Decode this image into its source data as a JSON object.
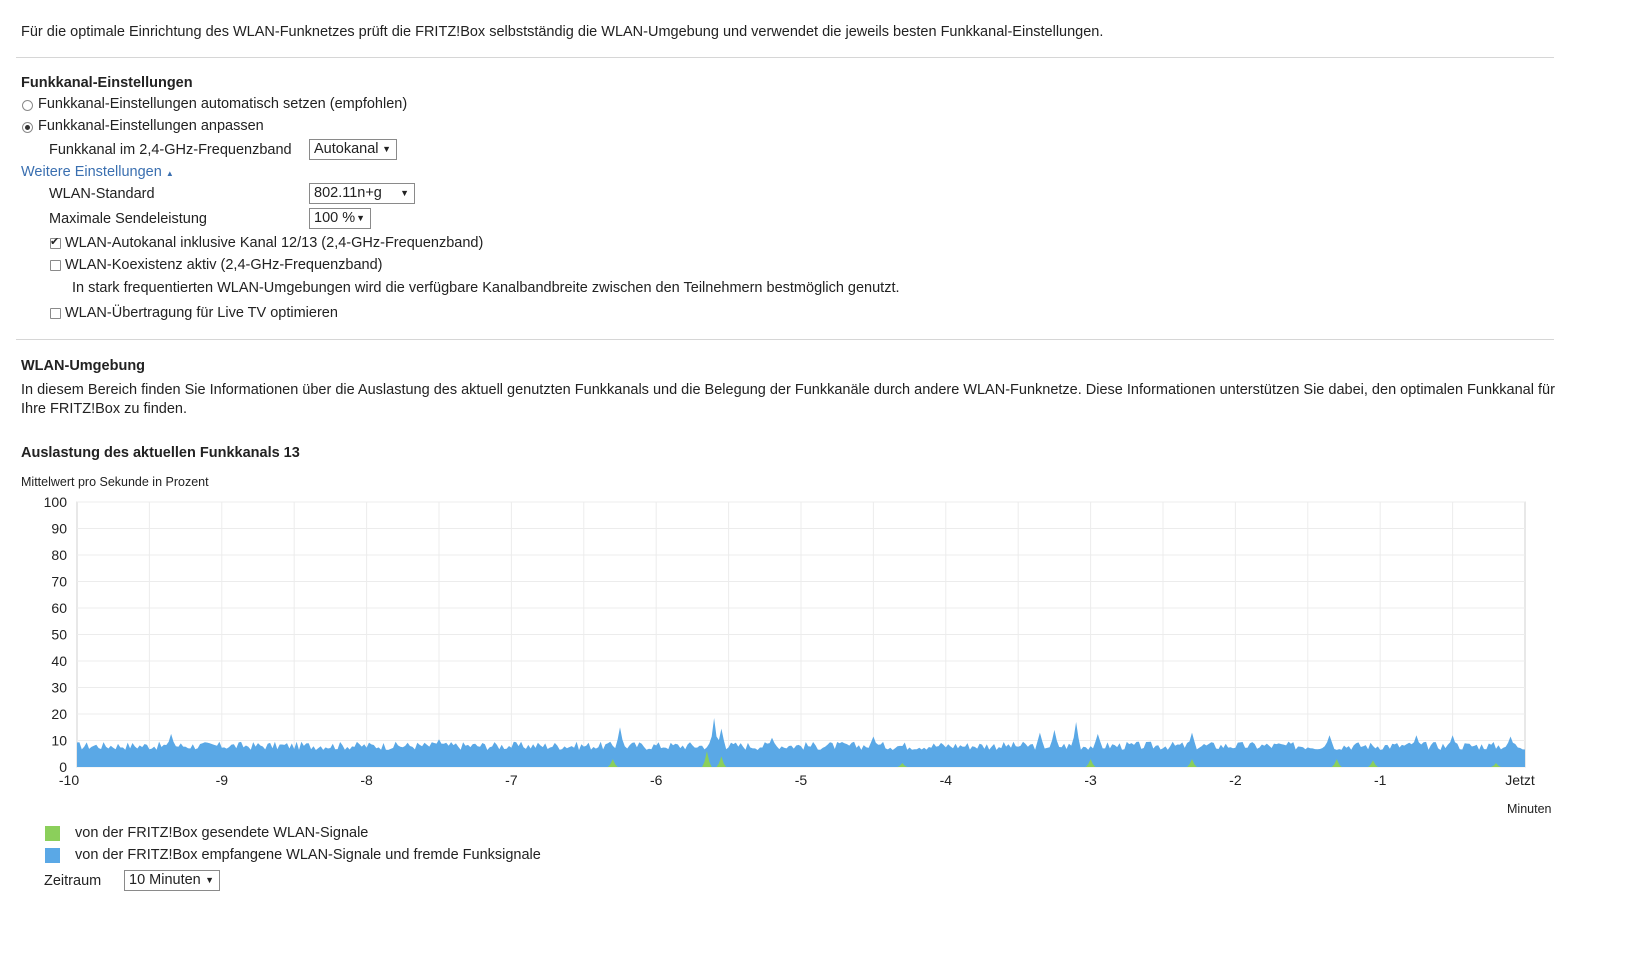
{
  "intro": "Für die optimale Einrichtung des WLAN-Funknetzes prüft die FRITZ!Box selbstständig die WLAN-Umgebung und verwendet die jeweils besten Funkkanal-Einstellungen.",
  "channel_settings": {
    "heading": "Funkkanal-Einstellungen",
    "radio_auto": "Funkkanal-Einstellungen automatisch setzen (empfohlen)",
    "radio_manual": "Funkkanal-Einstellungen anpassen",
    "selected_mode": "manual",
    "band_label": "Funkkanal im 2,4-GHz-Frequenzband",
    "band_value": "Autokanal"
  },
  "more_settings": {
    "link": "Weitere Einstellungen",
    "standard_label": "WLAN-Standard",
    "standard_value": "802.11n+g",
    "power_label": "Maximale Sendeleistung",
    "power_value": "100 %",
    "autochannel_label": "WLAN-Autokanal inklusive Kanal 12/13 (2,4-GHz-Frequenzband)",
    "autochannel_checked": true,
    "coexistence_label": "WLAN-Koexistenz aktiv (2,4-GHz-Frequenzband)",
    "coexistence_checked": false,
    "coexistence_hint": "In stark frequentierten WLAN-Umgebungen wird die verfügbare Kanalbandbreite zwischen den Teilnehmern bestmöglich genutzt.",
    "livetv_label": "WLAN-Übertragung für Live TV optimieren",
    "livetv_checked": false
  },
  "environment": {
    "heading": "WLAN-Umgebung",
    "description_line1": "In diesem Bereich finden Sie Informationen über die Auslastung des aktuell genutzten Funkkanals und die Belegung der Funkkanäle durch andere WLAN-Funknetze. Diese Informationen unterstützen Sie dabei, den optimalen Funkkanal für",
    "description_line2": "Ihre FRITZ!Box zu finden."
  },
  "chart_data": {
    "type": "area",
    "title": "Auslastung des aktuellen Funkkanals 13",
    "ylabel": "Mittelwert pro Sekunde in Prozent",
    "xlabel": "Minuten",
    "xlim": [
      -10,
      0
    ],
    "ylim": [
      0,
      100
    ],
    "x_ticks": [
      "-10",
      "-9",
      "-8",
      "-7",
      "-6",
      "-5",
      "-4",
      "-3",
      "-2",
      "-1",
      "Jetzt"
    ],
    "y_ticks": [
      0,
      10,
      20,
      30,
      40,
      50,
      60,
      70,
      80,
      90,
      100
    ],
    "grid": true,
    "series": [
      {
        "name": "von der FRITZ!Box empfangene WLAN-Signale und fremde Funksignale",
        "color": "#5aa8e6",
        "baseline": 8,
        "peaks": [
          [
            -9.35,
            12.5
          ],
          [
            -7.5,
            10.5
          ],
          [
            -6.25,
            15
          ],
          [
            -5.6,
            18.5
          ],
          [
            -5.55,
            14.5
          ],
          [
            -5.2,
            11
          ],
          [
            -4.5,
            11.5
          ],
          [
            -3.35,
            13
          ],
          [
            -3.25,
            14
          ],
          [
            -3.1,
            17
          ],
          [
            -2.95,
            12.5
          ],
          [
            -2.3,
            13
          ],
          [
            -1.35,
            12
          ],
          [
            -0.75,
            12
          ],
          [
            -0.5,
            12
          ],
          [
            -0.1,
            11.5
          ]
        ]
      },
      {
        "name": "von der FRITZ!Box gesendete WLAN-Signale",
        "color": "#8bcf5b",
        "baseline": 0,
        "peaks": [
          [
            -6.3,
            3
          ],
          [
            -5.65,
            6
          ],
          [
            -5.55,
            4
          ],
          [
            -4.3,
            1.5
          ],
          [
            -3.0,
            3
          ],
          [
            -2.3,
            3
          ],
          [
            -1.3,
            3
          ],
          [
            -1.05,
            2.5
          ],
          [
            -0.2,
            1.5
          ]
        ]
      }
    ],
    "legend_position": "bottom-left"
  },
  "legend": {
    "sent_label": "von der FRITZ!Box gesendete WLAN-Signale",
    "received_label": "von der FRITZ!Box empfangene WLAN-Signale und fremde Funksignale"
  },
  "period": {
    "label": "Zeitraum",
    "value": "10 Minuten"
  }
}
